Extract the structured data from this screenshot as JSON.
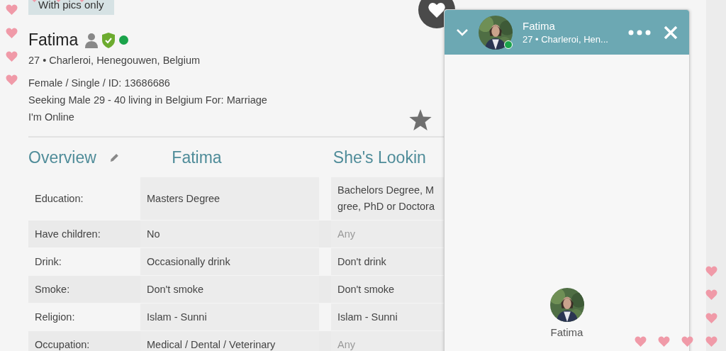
{
  "filter_chip": {
    "label": "With pics only"
  },
  "profile": {
    "name": "Fatima",
    "verified": true,
    "online": true,
    "lines": [
      "27 • Charleroi, Henegouwen, Belgium",
      "Female / Single / ID: 13686686",
      "Seeking Male 29 - 40 living in Belgium For: Marriage",
      "I'm Online"
    ]
  },
  "overview": {
    "title": "Overview",
    "columns": [
      "Fatima",
      "She's Lookin"
    ],
    "rows": [
      {
        "label": "Education:",
        "value": "Masters Degree",
        "wanted": [
          "Bachelors Degree, M",
          "gree, PhD or Doctora"
        ],
        "wanted_muted": false
      },
      {
        "label": "Have children:",
        "value": "No",
        "wanted": [
          "Any"
        ],
        "wanted_muted": true
      },
      {
        "label": "Drink:",
        "value": "Occasionally drink",
        "wanted": [
          "Don't drink"
        ],
        "wanted_muted": false
      },
      {
        "label": "Smoke:",
        "value": "Don't smoke",
        "wanted": [
          "Don't smoke"
        ],
        "wanted_muted": false
      },
      {
        "label": "Religion:",
        "value": "Islam - Sunni",
        "wanted": [
          "Islam - Sunni"
        ],
        "wanted_muted": false
      },
      {
        "label": "Occupation:",
        "value": "Medical / Dental / Veterinary",
        "wanted": [
          "Any"
        ],
        "wanted_muted": true
      }
    ]
  },
  "chat": {
    "name": "Fatima",
    "subtitle": "27 • Charleroi, Hen...",
    "online": true,
    "body_name": "Fatima"
  }
}
